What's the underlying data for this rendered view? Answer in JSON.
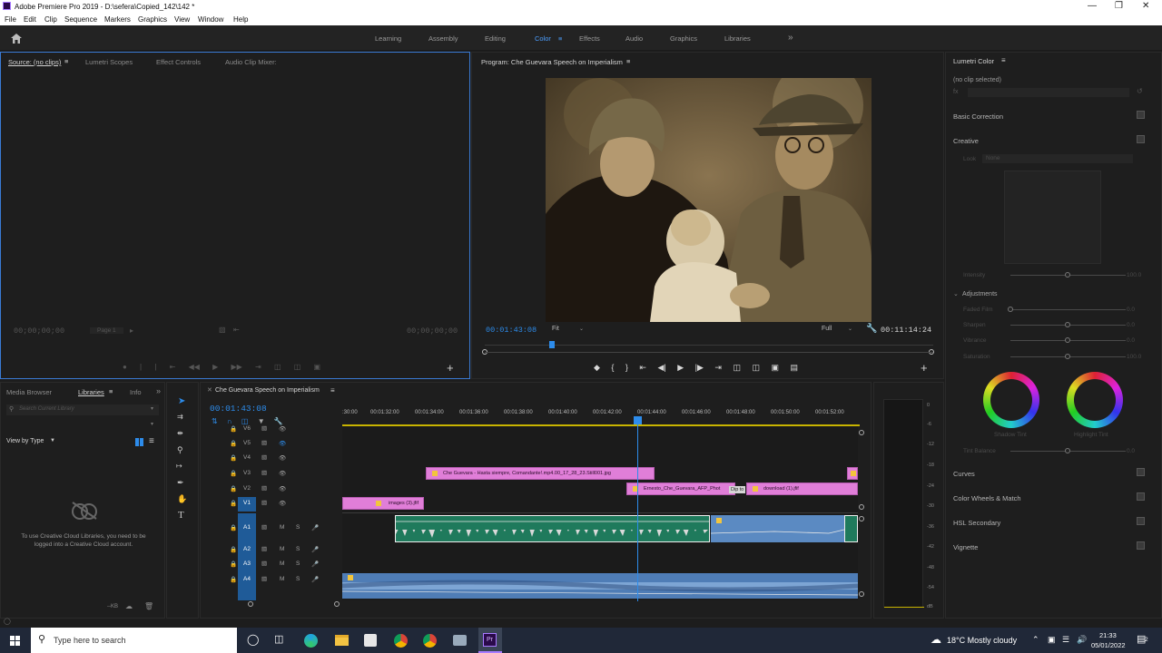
{
  "window": {
    "title": "Adobe Premiere Pro 2019 - D:\\sefera\\Copied_142\\142 *"
  },
  "menu": [
    "File",
    "Edit",
    "Clip",
    "Sequence",
    "Markers",
    "Graphics",
    "View",
    "Window",
    "Help"
  ],
  "workspaces": [
    "Learning",
    "Assembly",
    "Editing",
    "Color",
    "Effects",
    "Audio",
    "Graphics",
    "Libraries"
  ],
  "workspace_active": "Color",
  "source_panel": {
    "tabs": [
      "Source: (no clips)",
      "Lumetri Scopes",
      "Effect Controls",
      "Audio Clip Mixer:"
    ],
    "tc_left": "00;00;00;00",
    "tc_right": "00;00;00;00",
    "page": "Page 1"
  },
  "program_panel": {
    "title": "Program: Che Guevara Speech on Imperialism",
    "tc_current": "00:01:43:08",
    "fit": "Fit",
    "resolution": "Full",
    "tc_duration": "00:11:14:24"
  },
  "project_panel": {
    "tabs": [
      "Media Browser",
      "Libraries",
      "Info"
    ],
    "search_placeholder": "Search Current Library",
    "view_by": "View by Type",
    "message": "To use Creative Cloud Libraries, you need to be logged into a Creative Cloud account.",
    "footer": "--KB"
  },
  "timeline": {
    "title": "Che Guevara Speech on Imperialism",
    "tc": "00:01:43:08",
    "ruler": [
      ":30:00",
      "00:01:32:00",
      "00:01:34:00",
      "00:01:36:00",
      "00:01:38:00",
      "00:01:40:00",
      "00:01:42:00",
      "00:01:44:00",
      "00:01:46:00",
      "00:01:48:00",
      "00:01:50:00",
      "00:01:52:00"
    ],
    "video_tracks": [
      "V6",
      "V5",
      "V4",
      "V3",
      "V2",
      "V1"
    ],
    "audio_tracks": [
      "A1",
      "A2",
      "A3",
      "A4"
    ],
    "mute": "M",
    "solo": "S",
    "clips": {
      "v3": "Che Guevara - Hasta siempre, Comandante!.mp4.00_17_28_23.Still001.jpg",
      "v2a": "Ernesto_Che_Guevara_AFP_Phot",
      "v2b": "download (1).jfif",
      "v1": "images (3).jfif",
      "tooltip": "Dip to"
    }
  },
  "meter_scale": [
    "0",
    "-6",
    "-12",
    "-18",
    "-24",
    "-30",
    "-36",
    "-42",
    "-48",
    "-54",
    "dB"
  ],
  "lumetri": {
    "title": "Lumetri Color",
    "no_clip": "(no clip selected)",
    "sections": [
      "Basic Correction",
      "Creative",
      "Curves",
      "Color Wheels & Match",
      "HSL Secondary",
      "Vignette"
    ],
    "look": "Look",
    "look_value": "None",
    "intensity": "Intensity",
    "intensity_val": "100.0",
    "adjustments": "Adjustments",
    "sliders": [
      {
        "label": "Faded Film",
        "value": "0.0"
      },
      {
        "label": "Sharpen",
        "value": "0.0"
      },
      {
        "label": "Vibrance",
        "value": "0.0"
      },
      {
        "label": "Saturation",
        "value": "100.0"
      }
    ],
    "shadow_tint": "Shadow Tint",
    "highlight_tint": "Highlight Tint",
    "tint_balance": "Tint Balance",
    "tint_balance_val": "0.0"
  },
  "taskbar": {
    "search": "Type here to search",
    "weather": "18°C  Mostly cloudy",
    "time": "21:33",
    "date": "05/01/2022",
    "notif": "2"
  }
}
